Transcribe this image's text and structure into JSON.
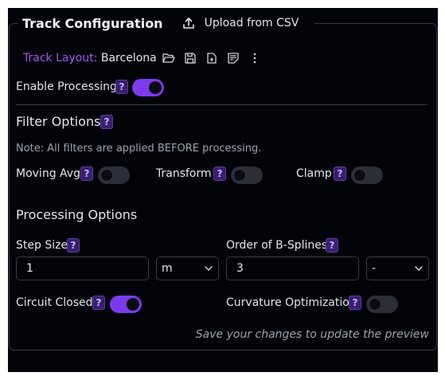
{
  "panel": {
    "title": "Track Configuration",
    "upload_label": "Upload from CSV"
  },
  "track_layout": {
    "label": "Track Layout:",
    "value": "Barcelona",
    "icons": [
      "folder-open-icon",
      "save-icon",
      "new-file-icon",
      "edit-notes-icon",
      "more-vertical-icon"
    ]
  },
  "processing": {
    "label": "Enable Processing",
    "help": "?",
    "enabled": true
  },
  "filter_options": {
    "heading": "Filter Options",
    "help": "?",
    "note": "Note: All filters are applied BEFORE processing.",
    "filters": [
      {
        "label": "Moving Avg",
        "help": "?",
        "enabled": false
      },
      {
        "label": "Transform",
        "help": "?",
        "enabled": false
      },
      {
        "label": "Clamp",
        "help": "?",
        "enabled": false
      }
    ]
  },
  "processing_options": {
    "heading": "Processing Options",
    "step_size": {
      "label": "Step Size",
      "help": "?",
      "value": "1",
      "unit": "m"
    },
    "bspline_order": {
      "label": "Order of B-Splines",
      "help": "?",
      "value": "3",
      "unit": "-"
    },
    "circuit_closed": {
      "label": "Circuit Closed",
      "help": "?",
      "enabled": true
    },
    "curvature_opt": {
      "label": "Curvature Optimization",
      "help": "?",
      "enabled": false
    },
    "save_hint": "Save your changes to update the preview"
  },
  "colors": {
    "accent": "#7c3aed",
    "track_label": "#a855f7",
    "background": "#03040a"
  }
}
